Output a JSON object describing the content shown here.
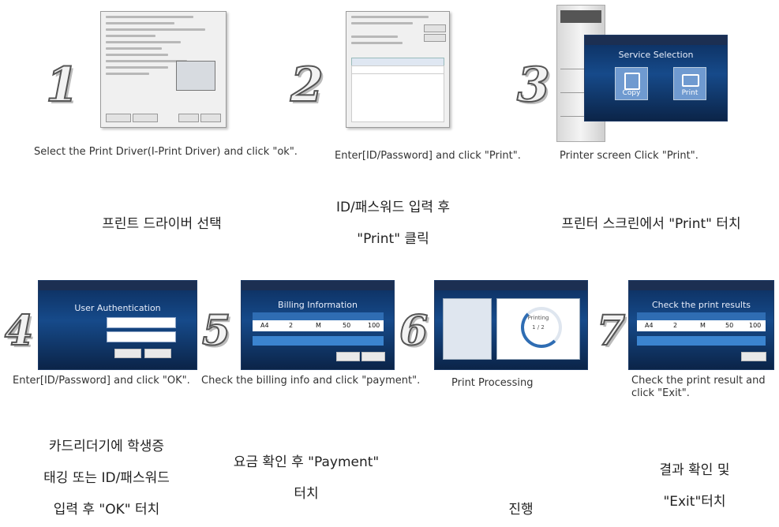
{
  "steps": [
    {
      "number": "1",
      "caption": "Select the Print Driver(I-Print Driver) and click \"ok\".",
      "korean": [
        "프린트 드라이버 선택"
      ]
    },
    {
      "number": "2",
      "caption": "Enter[ID/Password] and click \"Print\".",
      "korean": [
        "ID/패스워드 입력 후",
        "\"Print\" 클릭"
      ]
    },
    {
      "number": "3",
      "caption": "Printer screen Click \"Print\".",
      "korean": [
        "프린터 스크린에서 \"Print\" 터치"
      ]
    },
    {
      "number": "4",
      "caption": "Enter[ID/Password] and click \"OK\".",
      "korean": [
        "카드리더기에 학생증",
        "태깅 또는 ID/패스워드",
        "입력 후 \"OK\" 터치"
      ]
    },
    {
      "number": "5",
      "caption": "Check the billing info and click \"payment\".",
      "korean": [
        "요금 확인 후 \"Payment\"",
        "터치"
      ]
    },
    {
      "number": "6",
      "caption": "Print Processing",
      "korean": [
        "진행"
      ]
    },
    {
      "number": "7",
      "caption": "Check the print result and click \"Exit\".",
      "korean": [
        "결과 확인 및",
        "\"Exit\"터치"
      ]
    }
  ],
  "screens": {
    "s3": {
      "title": "Service Selection",
      "copy": "Copy",
      "print": "Print"
    },
    "s4": {
      "title": "User Authentication"
    },
    "s5": {
      "title": "Billing Information",
      "row": [
        "A4",
        "2",
        "M",
        "50",
        "100"
      ]
    },
    "s6": {
      "status": "Printing",
      "count": "1 / 2"
    },
    "s7": {
      "title": "Check the print results",
      "row": [
        "A4",
        "2",
        "M",
        "50",
        "100"
      ]
    }
  },
  "colors": {
    "kiosk_bg": "#164a8a",
    "number_fill": "#f2f2f2",
    "number_stroke": "#555555"
  }
}
